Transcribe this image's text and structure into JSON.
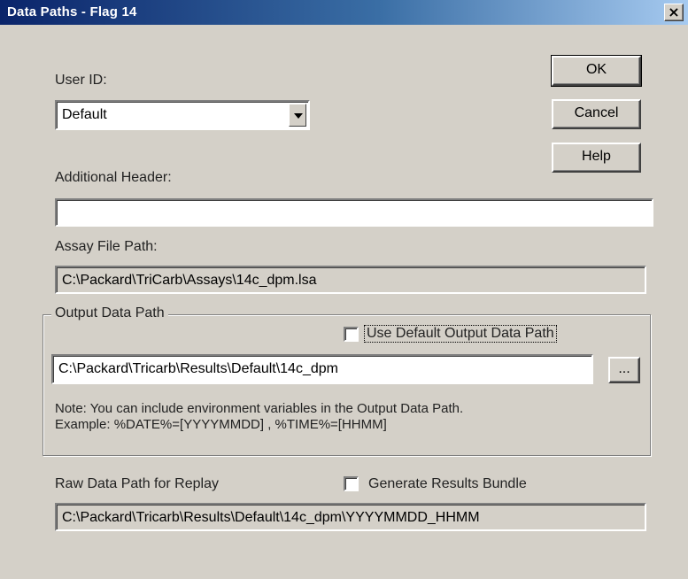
{
  "window": {
    "title": "Data Paths - Flag 14",
    "close_glyph": "×"
  },
  "user_id": {
    "label": "User ID:",
    "selected": "Default"
  },
  "buttons": {
    "ok": "OK",
    "cancel": "Cancel",
    "help": "Help"
  },
  "additional_header": {
    "label": "Additional Header:",
    "value": ""
  },
  "assay_file_path": {
    "label": "Assay File Path:",
    "value": "C:\\Packard\\TriCarb\\Assays\\14c_dpm.lsa"
  },
  "output_data_path": {
    "group_label": "Output Data Path",
    "use_default_label": "Use Default Output Data Path",
    "use_default_checked": false,
    "value": "C:\\Packard\\Tricarb\\Results\\Default\\14c_dpm",
    "browse_label": "...",
    "note_line1": "Note: You can include environment variables in the Output Data Path.",
    "note_line2": "Example:  %DATE%=[YYYYMMDD] ,     %TIME%=[HHMM]"
  },
  "raw_data_path": {
    "label": "Raw Data Path for Replay",
    "generate_bundle_label": "Generate Results Bundle",
    "generate_bundle_checked": false,
    "value": "C:\\Packard\\Tricarb\\Results\\Default\\14c_dpm\\YYYYMMDD_HHMM"
  }
}
